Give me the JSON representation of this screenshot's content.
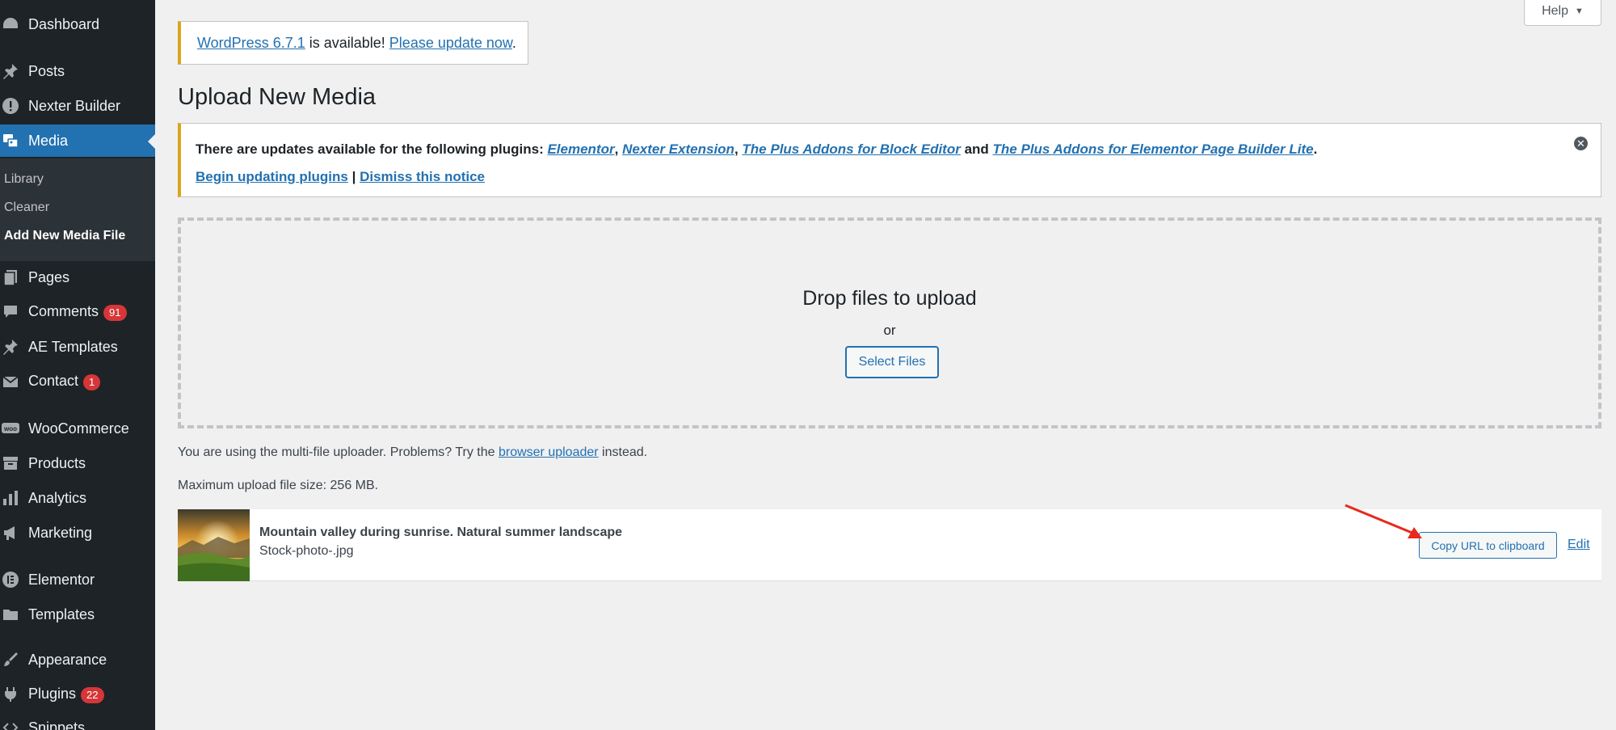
{
  "sidebar": {
    "items": [
      {
        "label": "Dashboard",
        "icon": "dashboard-icon"
      },
      {
        "label": "Posts",
        "icon": "pushpin-icon"
      },
      {
        "label": "Nexter Builder",
        "icon": "nexter-icon"
      },
      {
        "label": "Media",
        "icon": "media-icon"
      },
      {
        "label": "Pages",
        "icon": "pages-icon"
      },
      {
        "label": "Comments",
        "icon": "comment-icon",
        "badge": "91"
      },
      {
        "label": "AE Templates",
        "icon": "pushpin-icon"
      },
      {
        "label": "Contact",
        "icon": "mail-icon",
        "badge": "1"
      },
      {
        "label": "WooCommerce",
        "icon": "woo-icon"
      },
      {
        "label": "Products",
        "icon": "archive-icon"
      },
      {
        "label": "Analytics",
        "icon": "bar-chart-icon"
      },
      {
        "label": "Marketing",
        "icon": "megaphone-icon"
      },
      {
        "label": "Elementor",
        "icon": "elementor-icon"
      },
      {
        "label": "Templates",
        "icon": "folder-icon"
      },
      {
        "label": "Appearance",
        "icon": "brush-icon"
      },
      {
        "label": "Plugins",
        "icon": "plug-icon",
        "badge": "22"
      },
      {
        "label": "Snippets",
        "icon": "code-icon"
      }
    ],
    "submenu": [
      "Library",
      "Cleaner",
      "Add New Media File"
    ]
  },
  "help": {
    "label": "Help"
  },
  "update_nag": {
    "link1": "WordPress 6.7.1",
    "text": " is available! ",
    "link2": "Please update now",
    "end": "."
  },
  "page_title": "Upload New Media",
  "plugin_notice": {
    "intro": "There are updates available for the following plugins: ",
    "plugins": [
      "Elementor",
      "Nexter Extension",
      "The Plus Addons for Block Editor",
      "The Plus Addons for Elementor Page Builder Lite"
    ],
    "sep1": ", ",
    "sep2": ", ",
    "and": " and ",
    "end": ".",
    "begin_link": "Begin updating plugins",
    "divider": " | ",
    "dismiss_link": "Dismiss this notice"
  },
  "uploader": {
    "drop_text": "Drop files to upload",
    "or": "or",
    "select_button": "Select Files",
    "note_prefix": "You are using the multi-file uploader. Problems? Try the ",
    "note_link": "browser uploader",
    "note_suffix": " instead.",
    "max_size": "Maximum upload file size: 256 MB."
  },
  "media_item": {
    "title": "Mountain valley during sunrise. Natural summer landscape",
    "filename": "Stock-photo-.jpg",
    "copy_button": "Copy URL to clipboard",
    "edit_link": "Edit"
  },
  "colors": {
    "accent": "#2271b1",
    "sidebar_bg": "#1d2327",
    "notice_warning": "#dba617",
    "badge": "#d63638",
    "annotation_arrow": "#e8291c"
  }
}
